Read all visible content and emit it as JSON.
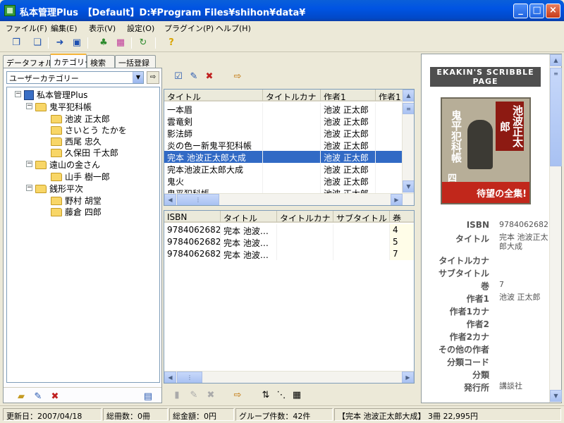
{
  "window": {
    "title": "私本管理Plus　【Default】D:¥Program Files¥shihon¥data¥",
    "minimize": "_",
    "maximize": "□",
    "close": "×"
  },
  "menu": [
    "ファイル(F)",
    "編集(E)",
    "表示(V)",
    "設定(O)",
    "プラグイン(P)",
    "ヘルプ(H)"
  ],
  "toolbar_icons": [
    "copy-icon",
    "copy-pages-icon",
    "import-icon",
    "export-icon",
    "tree-icon",
    "color-grid-icon",
    "refresh-icon",
    "help-icon"
  ],
  "tabs": [
    "データフォルダ",
    "カテゴリー",
    "検索",
    "一括登録"
  ],
  "category_combo": {
    "selected": "ユーザーカテゴリー"
  },
  "tree": {
    "root": "私本管理Plus",
    "nodes": [
      {
        "label": "鬼平犯科帳",
        "children": [
          "池波 正太郎",
          "さいとう たかを",
          "西尾 忠久",
          "久保田 千太郎"
        ]
      },
      {
        "label": "遠山の金さん",
        "children": [
          "山手 樹一郎"
        ]
      },
      {
        "label": "銭形平次",
        "children": [
          "野村 胡堂",
          "藤倉 四郎"
        ]
      }
    ]
  },
  "upper_list": {
    "columns": [
      "タイトル",
      "タイトルカナ",
      "作者1",
      "作者1:"
    ],
    "rows": [
      {
        "title": "一本眉",
        "kana": "",
        "author": "池波 正太郎"
      },
      {
        "title": "雲竜剣",
        "kana": "",
        "author": "池波 正太郎"
      },
      {
        "title": "影法師",
        "kana": "",
        "author": "池波 正太郎"
      },
      {
        "title": "炎の色ー新鬼平犯科帳",
        "kana": "",
        "author": "池波 正太郎"
      },
      {
        "title": "完本 池波正太郎大成",
        "kana": "",
        "author": "池波 正太郎"
      },
      {
        "title": "完本池波正太郎大成",
        "kana": "",
        "author": "池波 正太郎"
      },
      {
        "title": "鬼火",
        "kana": "",
        "author": "池波 正太郎"
      },
      {
        "title": "鬼平犯科帳",
        "kana": "",
        "author": "池波 正太郎"
      }
    ],
    "selected_index": 4
  },
  "lower_list": {
    "columns": [
      "ISBN",
      "タイトル",
      "タイトルカナ",
      "サブタイトル",
      "巻"
    ],
    "rows": [
      {
        "isbn": "9784062682…",
        "title": "完本 池波…",
        "kana": "",
        "sub": "",
        "vol": "4"
      },
      {
        "isbn": "9784062682…",
        "title": "完本 池波…",
        "kana": "",
        "sub": "",
        "vol": "5"
      },
      {
        "isbn": "9784062682…",
        "title": "完本 池波…",
        "kana": "",
        "sub": "",
        "vol": "7"
      }
    ]
  },
  "detail": {
    "banner": "EKAKIN'S SCRIBBLE PAGE",
    "cover": {
      "title": "鬼平犯科帳",
      "vol": "四",
      "author": "池波正太郎",
      "band": "待望の全集!"
    },
    "fields": [
      {
        "label": "ISBN",
        "value": "9784062682"
      },
      {
        "label": "タイトル",
        "value": "完本 池波正太郎大成"
      },
      {
        "label": "タイトルカナ",
        "value": ""
      },
      {
        "label": "サブタイトル",
        "value": ""
      },
      {
        "label": "巻",
        "value": "7"
      },
      {
        "label": "作者1",
        "value": "池波 正太郎"
      },
      {
        "label": "作者1カナ",
        "value": ""
      },
      {
        "label": "作者2",
        "value": ""
      },
      {
        "label": "作者2カナ",
        "value": ""
      },
      {
        "label": "その他の作者",
        "value": ""
      },
      {
        "label": "分類コード",
        "value": ""
      },
      {
        "label": "分類",
        "value": ""
      },
      {
        "label": "発行所",
        "value": "講談社"
      }
    ]
  },
  "status": {
    "updated": "更新日：2007/04/18",
    "count": "総冊数：0冊",
    "amount": "総金額：0円",
    "groups": "グループ件数：42件",
    "selection": "【完本 池波正太郎大成】 3冊  22,995円"
  },
  "colors": {
    "titlebar": "#0054e3",
    "selection": "#316ac5",
    "accent_tab": "#f5b43a"
  }
}
